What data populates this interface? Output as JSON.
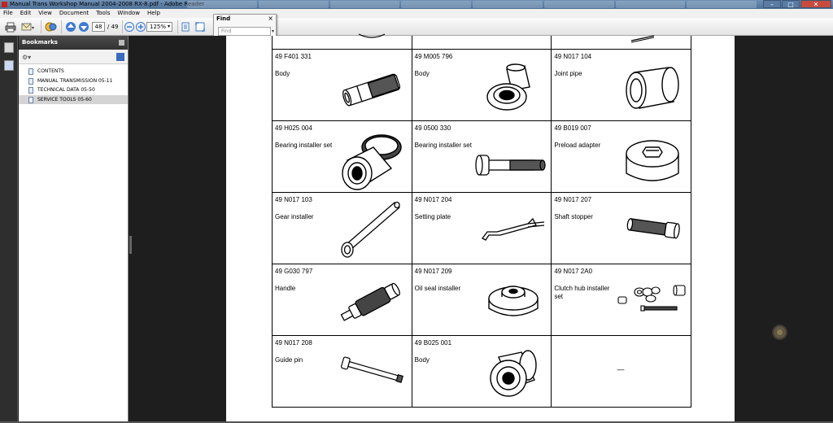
{
  "window": {
    "title": "Manual Trans Workshop Manual 2004-2008 RX-8.pdf - Adobe Reader",
    "controls": {
      "minimize": "–",
      "maximize": "□",
      "close": "✕"
    }
  },
  "menu": [
    "File",
    "Edit",
    "View",
    "Document",
    "Tools",
    "Window",
    "Help"
  ],
  "toolbar": {
    "page_number": "48",
    "page_total": "/ 49",
    "zoom": "125%"
  },
  "find": {
    "title": "Find",
    "close": "×",
    "placeholder": "Find"
  },
  "bookmarks": {
    "title": "Bookmarks",
    "items": [
      {
        "label": "CONTENTS"
      },
      {
        "label": "MANUAL TRANSMISSION 05-11"
      },
      {
        "label": "TECHNICAL DATA 05-50"
      },
      {
        "label": "SERVICE TOOLS 05-60",
        "selected": true
      }
    ]
  },
  "tools_table": {
    "rows": [
      [
        {
          "part_no": "49 F401 331",
          "name": "Body",
          "icon": "sleeve-tool-icon"
        },
        {
          "part_no": "49 M005 796",
          "name": "Body",
          "icon": "flanged-body-icon"
        },
        {
          "part_no": "49 N017 104",
          "name": "Joint pipe",
          "icon": "joint-pipe-icon"
        }
      ],
      [
        {
          "part_no": "49 H025 004",
          "name": "Bearing installer set",
          "icon": "bearing-installer-icon"
        },
        {
          "part_no": "49 0500 330",
          "name": "Bearing installer set",
          "icon": "bearing-installer-bolt-icon"
        },
        {
          "part_no": "49 B019 007",
          "name": "Preload adapter",
          "icon": "preload-adapter-icon"
        }
      ],
      [
        {
          "part_no": "49 N017 103",
          "name": "Gear installer",
          "icon": "gear-installer-icon"
        },
        {
          "part_no": "49 N017 204",
          "name": "Setting plate",
          "icon": "setting-plate-icon"
        },
        {
          "part_no": "49 N017 207",
          "name": "Shaft stopper",
          "icon": "shaft-stopper-icon"
        }
      ],
      [
        {
          "part_no": "49 G030 797",
          "name": "Handle",
          "icon": "handle-icon"
        },
        {
          "part_no": "49 N017 209",
          "name": "Oil seal installer",
          "icon": "oil-seal-installer-icon"
        },
        {
          "part_no": "49 N017 2A0",
          "name": "Clutch hub installer set",
          "icon": "clutch-hub-installer-icon"
        }
      ],
      [
        {
          "part_no": "49 N017 208",
          "name": "Guide pin",
          "icon": "guide-pin-icon"
        },
        {
          "part_no": "49 B025 001",
          "name": "Body",
          "icon": "body-collar-icon"
        },
        {
          "part_no": "",
          "name": "",
          "icon": "",
          "mark": "—"
        }
      ]
    ]
  }
}
